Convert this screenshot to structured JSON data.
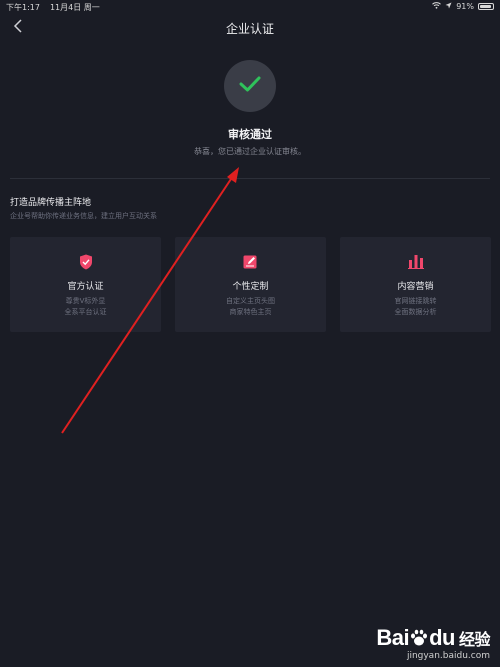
{
  "status_bar": {
    "time": "下午1:17",
    "date": "11月4日 周一",
    "battery_text": "91%",
    "battery_level": 0.91,
    "wifi_icon": "wifi-icon",
    "location_icon": "location-icon"
  },
  "nav": {
    "title": "企业认证",
    "back_icon": "back-icon"
  },
  "review": {
    "icon": "checkmark-icon",
    "title": "审核通过",
    "subtitle": "恭喜，您已通过企业认证审核。"
  },
  "section": {
    "title": "打造品牌传播主阵地",
    "subtitle": "企业号帮助你传递业务信息，建立用户互动关系"
  },
  "cards": [
    {
      "icon": "shield-icon",
      "title": "官方认证",
      "desc_line1": "尊贵V标外显",
      "desc_line2": "全系平台认证"
    },
    {
      "icon": "edit-icon",
      "title": "个性定制",
      "desc_line1": "自定义主页头图",
      "desc_line2": "商家特色主页"
    },
    {
      "icon": "bar-chart-icon",
      "title": "内容营销",
      "desc_line1": "官网链接跳转",
      "desc_line2": "全面数据分析"
    }
  ],
  "colors": {
    "background": "#1a1c25",
    "card_background": "#232530",
    "check_green": "#2fc25b",
    "icon_red": "#f0476b",
    "annotation_arrow": "#e02020"
  },
  "watermark": {
    "logo_text": "Bai",
    "logo_text_2": "du",
    "suffix": "经验",
    "url": "jingyan.baidu.com"
  }
}
